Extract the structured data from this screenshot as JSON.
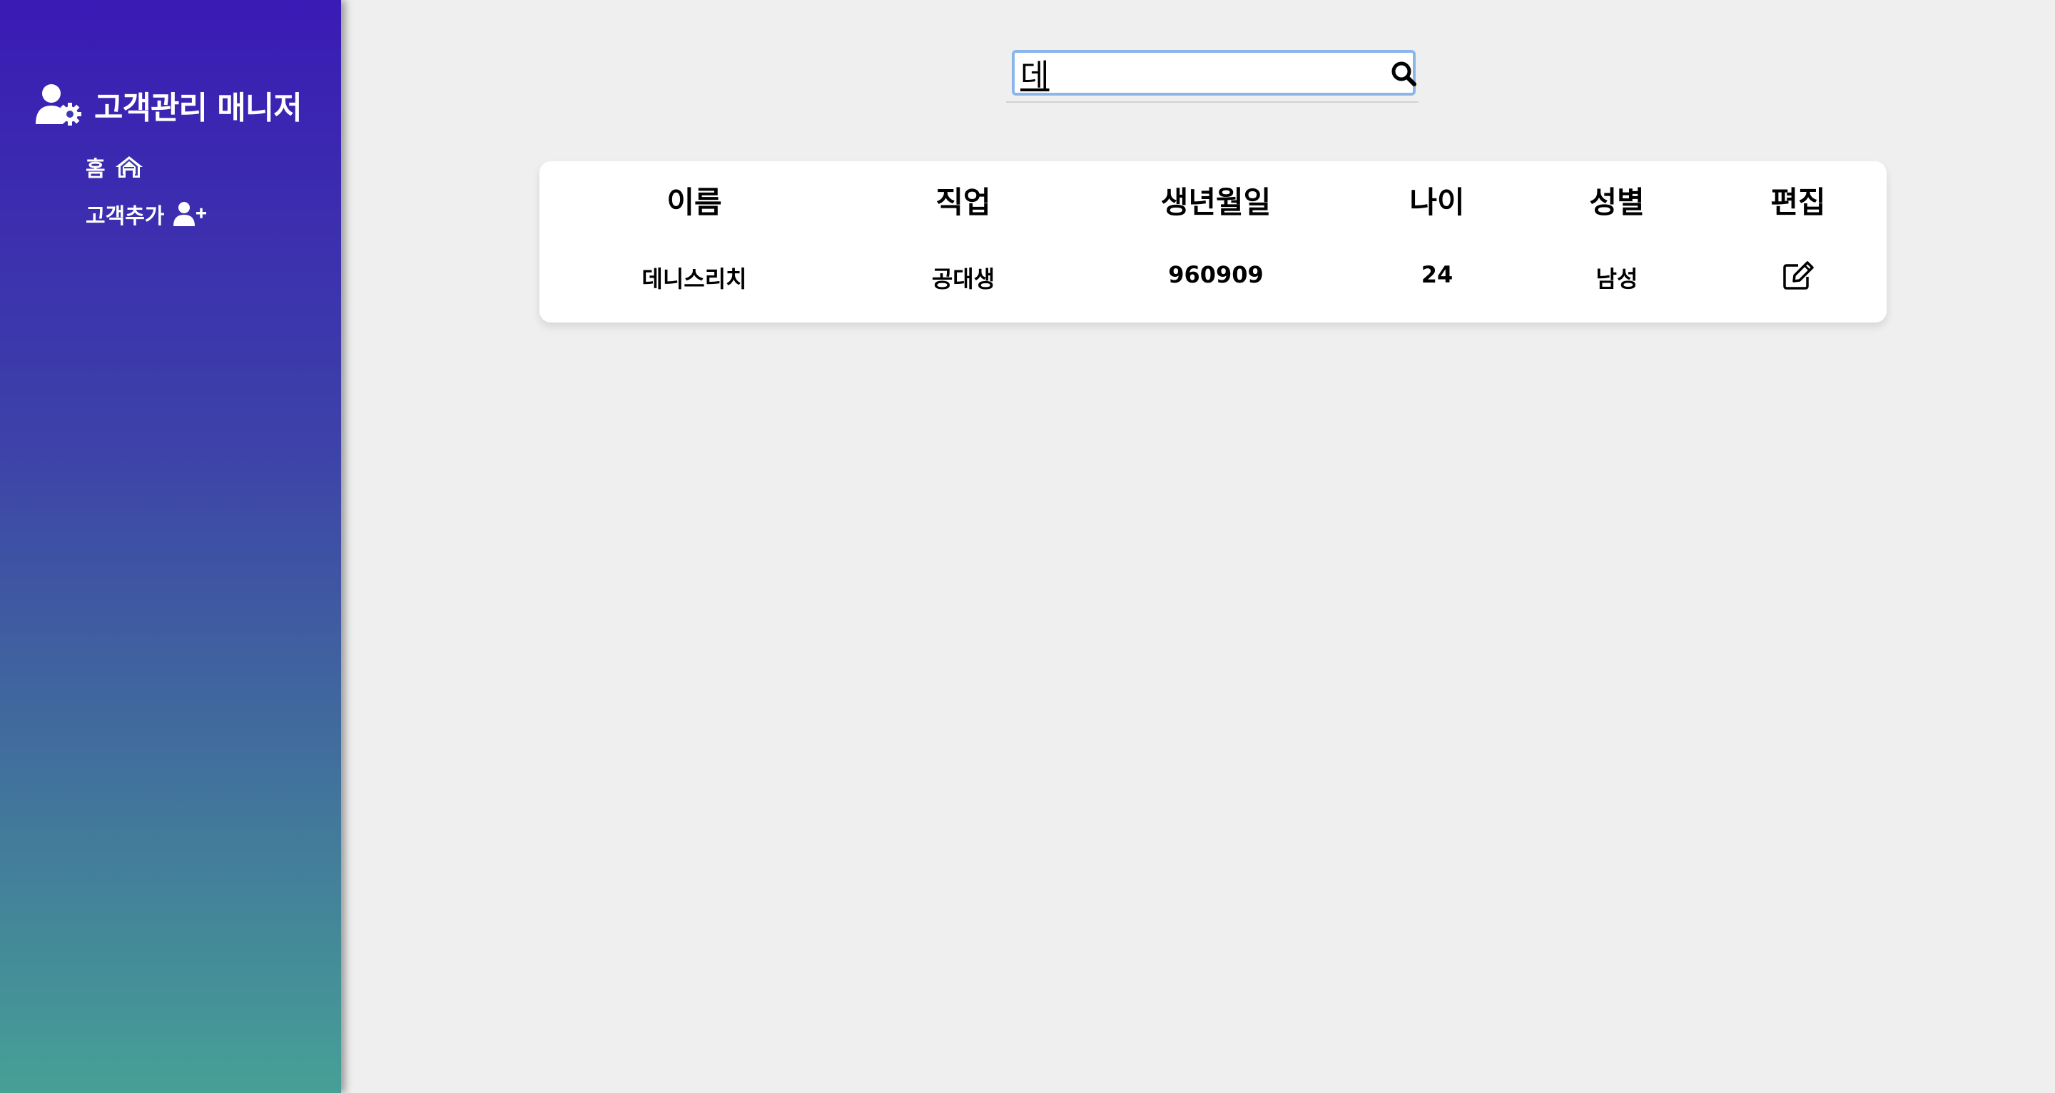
{
  "sidebar": {
    "title": "고객관리 매니저",
    "title_icon": "user-gear-icon",
    "items": [
      {
        "label": "홈",
        "icon": "home-icon"
      },
      {
        "label": "고객추가",
        "icon": "user-plus-icon"
      }
    ]
  },
  "search": {
    "value": "데",
    "icon": "search-icon"
  },
  "table": {
    "headers": [
      "이름",
      "직업",
      "생년월일",
      "나이",
      "성별",
      "편집"
    ],
    "rows": [
      {
        "name": "데니스리치",
        "job": "공대생",
        "birth": "960909",
        "age": "24",
        "gender": "남성",
        "edit_icon": "edit-icon"
      }
    ]
  },
  "colors": {
    "sidebar_top": "#3a1bb5",
    "sidebar_bottom": "#46a096",
    "background": "#efefef",
    "search_focus": "#8ab6ea"
  }
}
